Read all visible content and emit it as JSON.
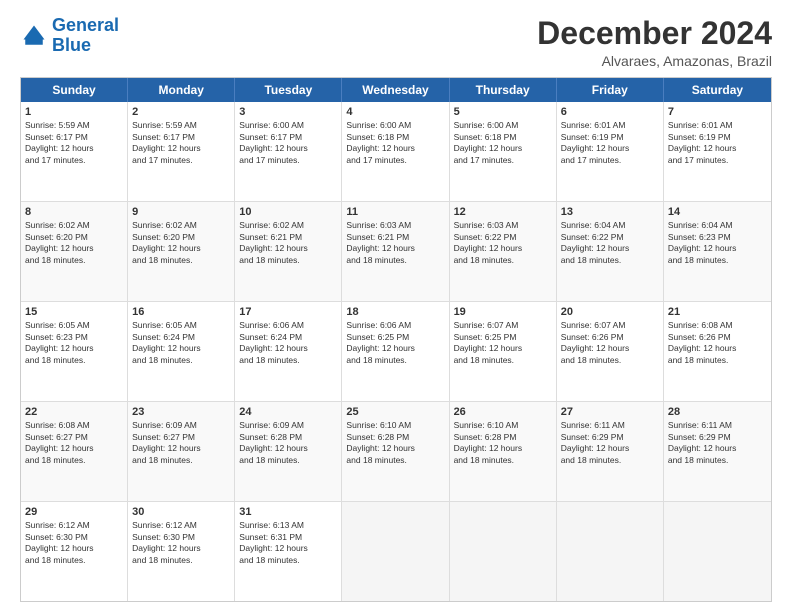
{
  "logo": {
    "line1": "General",
    "line2": "Blue"
  },
  "header": {
    "month": "December 2024",
    "location": "Alvaraes, Amazonas, Brazil"
  },
  "weekdays": [
    "Sunday",
    "Monday",
    "Tuesday",
    "Wednesday",
    "Thursday",
    "Friday",
    "Saturday"
  ],
  "weeks": [
    [
      {
        "day": "1",
        "info": "Sunrise: 5:59 AM\nSunset: 6:17 PM\nDaylight: 12 hours\nand 17 minutes."
      },
      {
        "day": "2",
        "info": "Sunrise: 5:59 AM\nSunset: 6:17 PM\nDaylight: 12 hours\nand 17 minutes."
      },
      {
        "day": "3",
        "info": "Sunrise: 6:00 AM\nSunset: 6:17 PM\nDaylight: 12 hours\nand 17 minutes."
      },
      {
        "day": "4",
        "info": "Sunrise: 6:00 AM\nSunset: 6:18 PM\nDaylight: 12 hours\nand 17 minutes."
      },
      {
        "day": "5",
        "info": "Sunrise: 6:00 AM\nSunset: 6:18 PM\nDaylight: 12 hours\nand 17 minutes."
      },
      {
        "day": "6",
        "info": "Sunrise: 6:01 AM\nSunset: 6:19 PM\nDaylight: 12 hours\nand 17 minutes."
      },
      {
        "day": "7",
        "info": "Sunrise: 6:01 AM\nSunset: 6:19 PM\nDaylight: 12 hours\nand 17 minutes."
      }
    ],
    [
      {
        "day": "8",
        "info": "Sunrise: 6:02 AM\nSunset: 6:20 PM\nDaylight: 12 hours\nand 18 minutes."
      },
      {
        "day": "9",
        "info": "Sunrise: 6:02 AM\nSunset: 6:20 PM\nDaylight: 12 hours\nand 18 minutes."
      },
      {
        "day": "10",
        "info": "Sunrise: 6:02 AM\nSunset: 6:21 PM\nDaylight: 12 hours\nand 18 minutes."
      },
      {
        "day": "11",
        "info": "Sunrise: 6:03 AM\nSunset: 6:21 PM\nDaylight: 12 hours\nand 18 minutes."
      },
      {
        "day": "12",
        "info": "Sunrise: 6:03 AM\nSunset: 6:22 PM\nDaylight: 12 hours\nand 18 minutes."
      },
      {
        "day": "13",
        "info": "Sunrise: 6:04 AM\nSunset: 6:22 PM\nDaylight: 12 hours\nand 18 minutes."
      },
      {
        "day": "14",
        "info": "Sunrise: 6:04 AM\nSunset: 6:23 PM\nDaylight: 12 hours\nand 18 minutes."
      }
    ],
    [
      {
        "day": "15",
        "info": "Sunrise: 6:05 AM\nSunset: 6:23 PM\nDaylight: 12 hours\nand 18 minutes."
      },
      {
        "day": "16",
        "info": "Sunrise: 6:05 AM\nSunset: 6:24 PM\nDaylight: 12 hours\nand 18 minutes."
      },
      {
        "day": "17",
        "info": "Sunrise: 6:06 AM\nSunset: 6:24 PM\nDaylight: 12 hours\nand 18 minutes."
      },
      {
        "day": "18",
        "info": "Sunrise: 6:06 AM\nSunset: 6:25 PM\nDaylight: 12 hours\nand 18 minutes."
      },
      {
        "day": "19",
        "info": "Sunrise: 6:07 AM\nSunset: 6:25 PM\nDaylight: 12 hours\nand 18 minutes."
      },
      {
        "day": "20",
        "info": "Sunrise: 6:07 AM\nSunset: 6:26 PM\nDaylight: 12 hours\nand 18 minutes."
      },
      {
        "day": "21",
        "info": "Sunrise: 6:08 AM\nSunset: 6:26 PM\nDaylight: 12 hours\nand 18 minutes."
      }
    ],
    [
      {
        "day": "22",
        "info": "Sunrise: 6:08 AM\nSunset: 6:27 PM\nDaylight: 12 hours\nand 18 minutes."
      },
      {
        "day": "23",
        "info": "Sunrise: 6:09 AM\nSunset: 6:27 PM\nDaylight: 12 hours\nand 18 minutes."
      },
      {
        "day": "24",
        "info": "Sunrise: 6:09 AM\nSunset: 6:28 PM\nDaylight: 12 hours\nand 18 minutes."
      },
      {
        "day": "25",
        "info": "Sunrise: 6:10 AM\nSunset: 6:28 PM\nDaylight: 12 hours\nand 18 minutes."
      },
      {
        "day": "26",
        "info": "Sunrise: 6:10 AM\nSunset: 6:28 PM\nDaylight: 12 hours\nand 18 minutes."
      },
      {
        "day": "27",
        "info": "Sunrise: 6:11 AM\nSunset: 6:29 PM\nDaylight: 12 hours\nand 18 minutes."
      },
      {
        "day": "28",
        "info": "Sunrise: 6:11 AM\nSunset: 6:29 PM\nDaylight: 12 hours\nand 18 minutes."
      }
    ],
    [
      {
        "day": "29",
        "info": "Sunrise: 6:12 AM\nSunset: 6:30 PM\nDaylight: 12 hours\nand 18 minutes."
      },
      {
        "day": "30",
        "info": "Sunrise: 6:12 AM\nSunset: 6:30 PM\nDaylight: 12 hours\nand 18 minutes."
      },
      {
        "day": "31",
        "info": "Sunrise: 6:13 AM\nSunset: 6:31 PM\nDaylight: 12 hours\nand 18 minutes."
      },
      {
        "day": "",
        "info": ""
      },
      {
        "day": "",
        "info": ""
      },
      {
        "day": "",
        "info": ""
      },
      {
        "day": "",
        "info": ""
      }
    ]
  ]
}
